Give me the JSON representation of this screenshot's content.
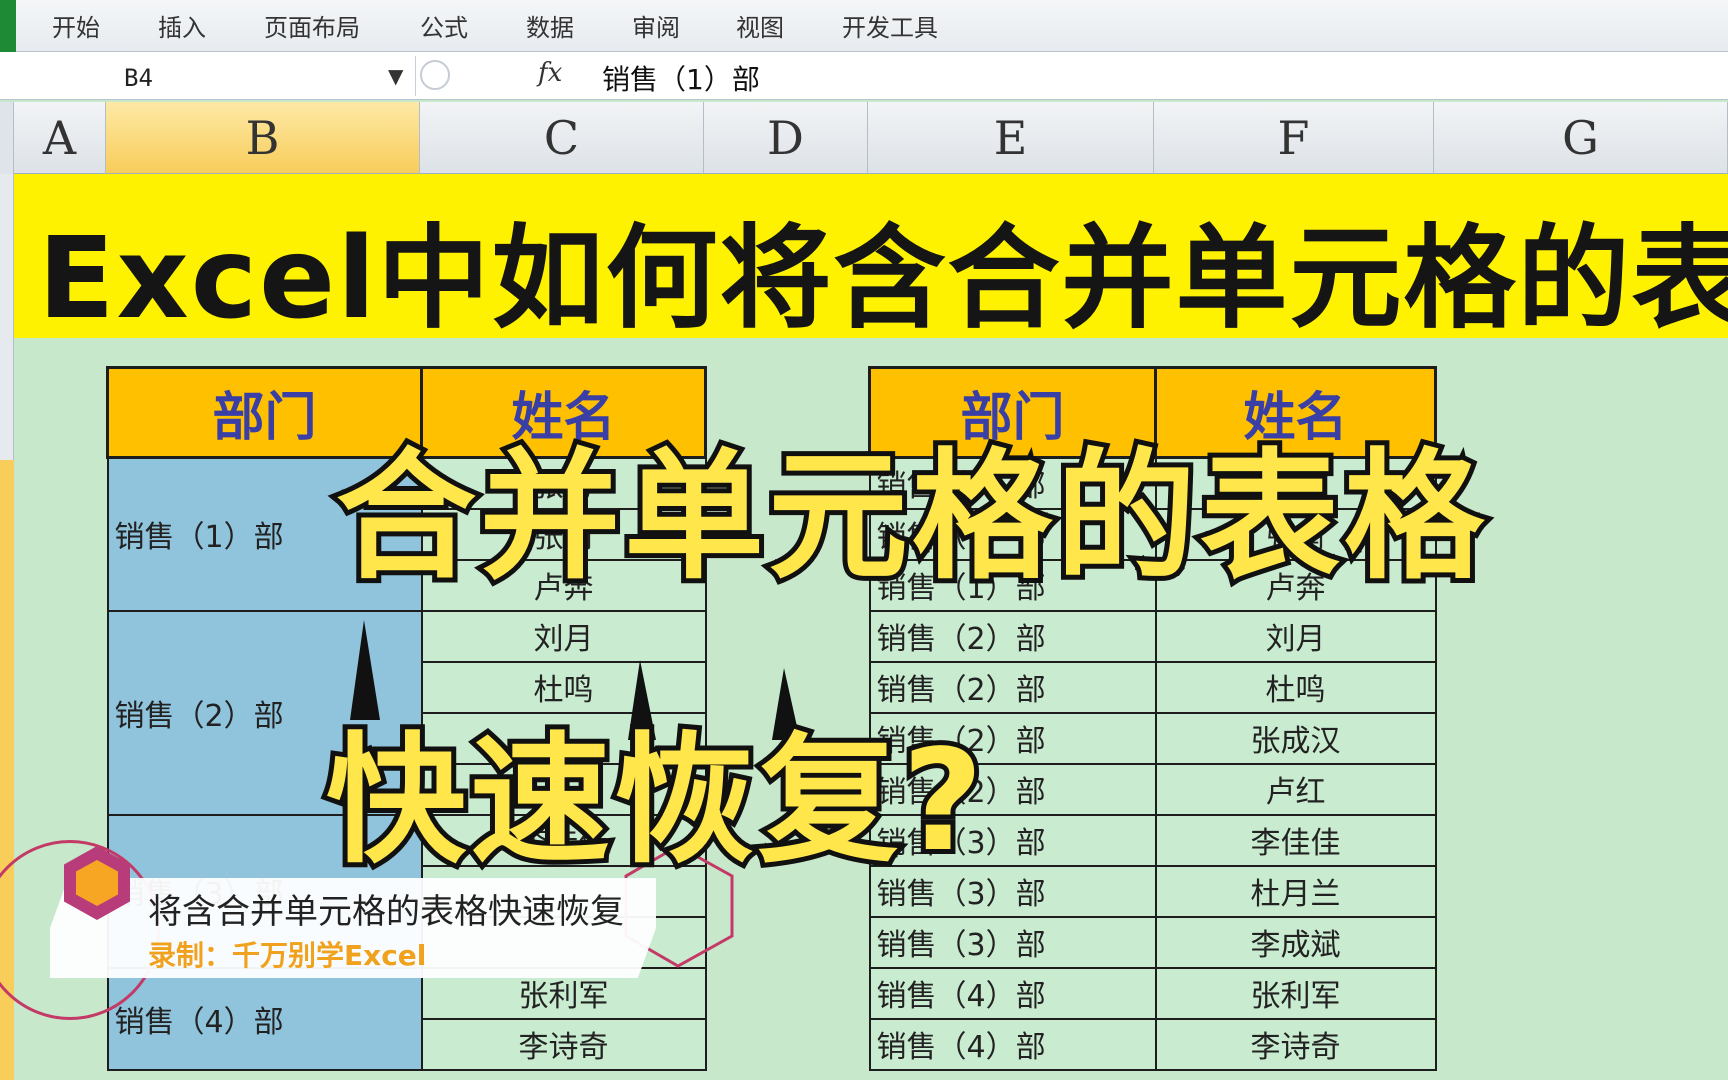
{
  "ribbon": {
    "tabs": [
      "开始",
      "插入",
      "页面布局",
      "公式",
      "数据",
      "审阅",
      "视图",
      "开发工具"
    ]
  },
  "formula_bar": {
    "name_box": "B4",
    "fx_label": "fx",
    "content": "销售（1）部"
  },
  "columns": [
    "A",
    "B",
    "C",
    "D",
    "E",
    "F",
    "G"
  ],
  "selected_column": "B",
  "banner": {
    "title": "Excel中如何将含合并单元格的表格"
  },
  "left_table": {
    "headers": [
      "部门",
      "姓名"
    ],
    "groups": [
      {
        "dept": "销售（1）部",
        "names": [
          "张勇",
          "张南",
          "卢奔"
        ]
      },
      {
        "dept": "销售（2）部",
        "names": [
          "刘月",
          "杜鸣",
          "",
          ""
        ]
      },
      {
        "dept": "销售（3）部",
        "names": [
          "李佳佳",
          "",
          ""
        ]
      },
      {
        "dept": "销售（4）部",
        "names": [
          "张利军",
          "李诗奇"
        ]
      }
    ]
  },
  "right_table": {
    "headers": [
      "部门",
      "姓名"
    ],
    "rows": [
      [
        "销售（1）部",
        "张勇"
      ],
      [
        "销售（1）部",
        "张南"
      ],
      [
        "销售（1）部",
        "卢奔"
      ],
      [
        "销售（2）部",
        "刘月"
      ],
      [
        "销售（2）部",
        "杜鸣"
      ],
      [
        "销售（2）部",
        "张成汉"
      ],
      [
        "销售（2）部",
        "卢红"
      ],
      [
        "销售（3）部",
        "李佳佳"
      ],
      [
        "销售（3）部",
        "杜月兰"
      ],
      [
        "销售（3）部",
        "李成斌"
      ],
      [
        "销售（4）部",
        "张利军"
      ],
      [
        "销售（4）部",
        "李诗奇"
      ]
    ]
  },
  "overlay": {
    "line1": "合并单元格的表格",
    "line2": "快速恢复?"
  },
  "watermark": {
    "title": "将含合并单元格的表格快速恢复",
    "subtitle": "录制：千万别学Excel"
  },
  "colors": {
    "banner": "#fff200",
    "header_fill": "#ffc000",
    "header_text": "#3a3fa6",
    "merged_fill": "#8fc4dc",
    "sheet_bg": "#c9ebd0",
    "overlay_text": "#ffe64a"
  }
}
